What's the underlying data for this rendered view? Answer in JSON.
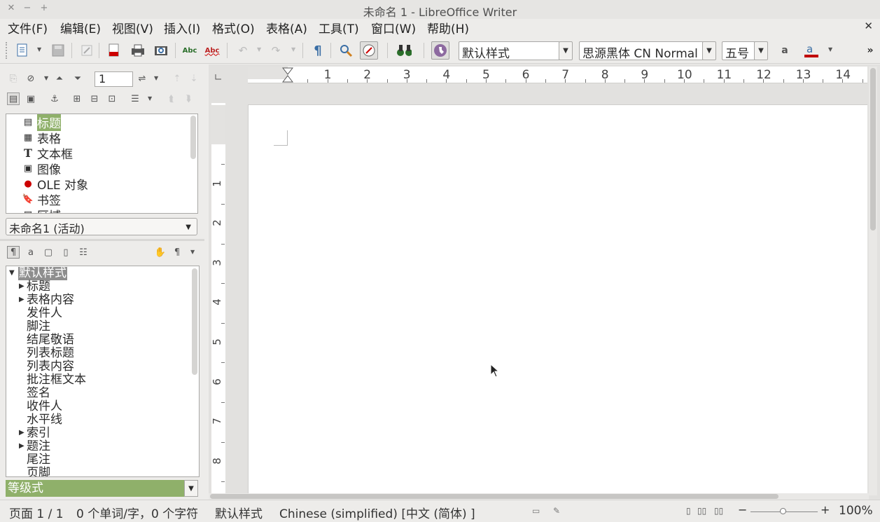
{
  "window": {
    "title": "未命名 1 - LibreOffice Writer",
    "close": "✕",
    "minimize": "−",
    "maximize": "+"
  },
  "menu": {
    "items": [
      "文件(F)",
      "编辑(E)",
      "视图(V)",
      "插入(I)",
      "格式(O)",
      "表格(A)",
      "工具(T)",
      "窗口(W)",
      "帮助(H)"
    ],
    "close_doc": "✕"
  },
  "toolbar": {
    "paragraph_style": "默认样式",
    "font_name": "思源黑体 CN Normal",
    "font_size": "五号",
    "overflow": "»"
  },
  "navigator": {
    "page_number": "1",
    "items": [
      {
        "label": "标题",
        "icon": "heading-icon"
      },
      {
        "label": "表格",
        "icon": "table-icon"
      },
      {
        "label": "文本框",
        "icon": "textframe-icon"
      },
      {
        "label": "图像",
        "icon": "image-icon"
      },
      {
        "label": "OLE 对象",
        "icon": "ole-object-icon"
      },
      {
        "label": "书签",
        "icon": "bookmark-icon"
      },
      {
        "label": "区域",
        "icon": "section-icon"
      }
    ],
    "document": "未命名1 (活动)"
  },
  "styles": {
    "items": [
      {
        "label": "默认样式",
        "expanded": true,
        "level": 0
      },
      {
        "label": "标题",
        "expandable": true,
        "level": 1
      },
      {
        "label": "表格内容",
        "expandable": true,
        "level": 1
      },
      {
        "label": "发件人",
        "level": 1
      },
      {
        "label": "脚注",
        "level": 1
      },
      {
        "label": "结尾敬语",
        "level": 1
      },
      {
        "label": "列表标题",
        "level": 1
      },
      {
        "label": "列表内容",
        "level": 1
      },
      {
        "label": "批注框文本",
        "level": 1
      },
      {
        "label": "签名",
        "level": 1
      },
      {
        "label": "收件人",
        "level": 1
      },
      {
        "label": "水平线",
        "level": 1
      },
      {
        "label": "索引",
        "expandable": true,
        "level": 1
      },
      {
        "label": "题注",
        "expandable": true,
        "level": 1
      },
      {
        "label": "尾注",
        "level": 1
      },
      {
        "label": "页脚",
        "level": 1
      }
    ],
    "filter": "等级式"
  },
  "ruler": {
    "h_numbers": [
      "1",
      "2",
      "3",
      "4",
      "5",
      "6",
      "7",
      "8",
      "9",
      "10",
      "11",
      "12",
      "13",
      "14"
    ],
    "v_numbers": [
      "1",
      "2",
      "3",
      "4",
      "5",
      "6",
      "7",
      "8"
    ]
  },
  "status": {
    "page": "页面 1 / 1",
    "words": "0 个单词/字，0 个字符",
    "style": "默认样式",
    "language": "Chinese (simplified) [中文 (简体) ]",
    "zoom": "100%",
    "zoom_minus": "−",
    "zoom_plus": "+"
  },
  "colors": {
    "highlight": "#8fb06a",
    "font_color": "#c00000"
  }
}
